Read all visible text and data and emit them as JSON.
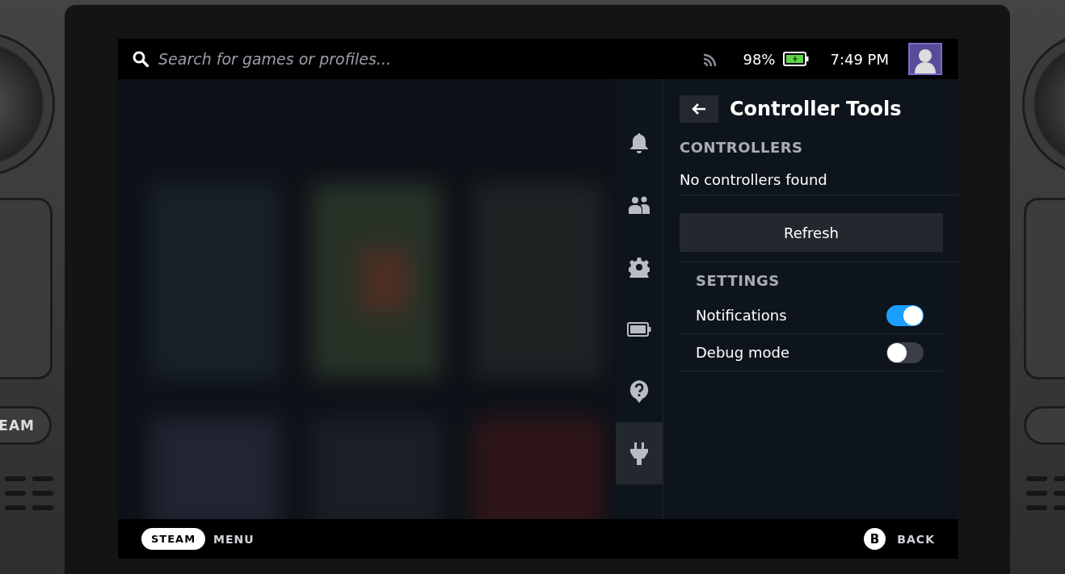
{
  "hardware": {
    "left_button": "EAM"
  },
  "search": {
    "placeholder": "Search for games or profiles..."
  },
  "status": {
    "battery": "98%",
    "time": "7:49 PM"
  },
  "rail": [
    {
      "kind": "bell",
      "selected": false
    },
    {
      "kind": "friends",
      "selected": false
    },
    {
      "kind": "gear",
      "selected": false
    },
    {
      "kind": "battery",
      "selected": false
    },
    {
      "kind": "help",
      "selected": false
    },
    {
      "kind": "plug",
      "selected": true
    }
  ],
  "panel": {
    "title": "Controller Tools",
    "controllers_heading": "CONTROLLERS",
    "controllers_message": "No controllers found",
    "refresh_button": "Refresh",
    "settings_heading": "SETTINGS",
    "settings": [
      {
        "label": "Notifications",
        "on": true
      },
      {
        "label": "Debug mode",
        "on": false
      }
    ]
  },
  "footer": {
    "left_key": "STEAM",
    "left_label": "MENU",
    "right_key": "B",
    "right_label": "BACK"
  }
}
